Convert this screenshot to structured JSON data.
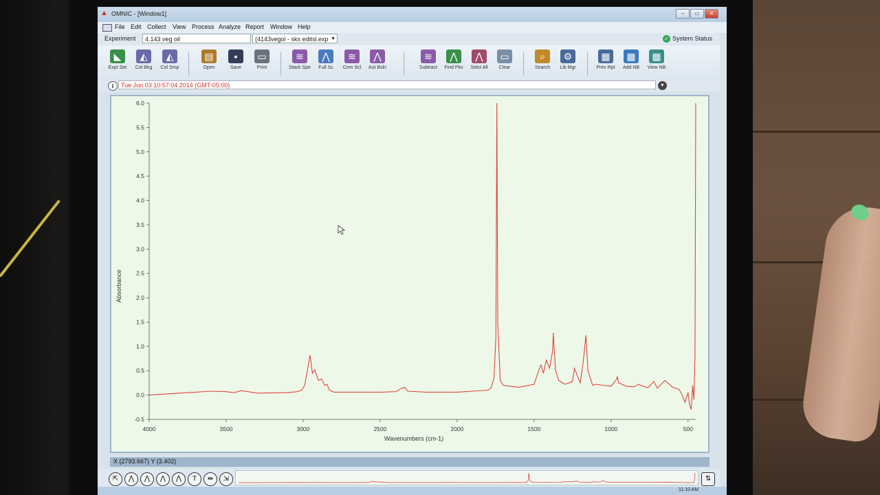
{
  "window": {
    "title": "OMNIC - [Window1]",
    "buttons": {
      "minimize": "–",
      "maximize": "▭",
      "close": "✕"
    }
  },
  "menu": [
    "File",
    "Edit",
    "Collect",
    "View",
    "Process",
    "Analyze",
    "Report",
    "Window",
    "Help"
  ],
  "experiment": {
    "label": "Experiment",
    "name": "4.143 veg oil",
    "file": "(4143vegoi - sks editsl.exp"
  },
  "system_status": "System Status",
  "toolbar": [
    {
      "label": "Expt Set",
      "icon": "expt-set-icon",
      "color": "#3a8f4a"
    },
    {
      "label": "Col Bkg",
      "icon": "collect-background-icon",
      "color": "#6a6aa8"
    },
    {
      "label": "Col Smp",
      "icon": "collect-sample-icon",
      "color": "#6a6aa8"
    },
    {
      "label": "Open",
      "icon": "open-icon",
      "color": "#b07a2a"
    },
    {
      "label": "Save",
      "icon": "save-icon",
      "color": "#333d55"
    },
    {
      "label": "Print",
      "icon": "print-icon",
      "color": "#6a7280"
    },
    {
      "label": "Stack Spe",
      "icon": "stack-spectra-icon",
      "color": "#8a5aa8"
    },
    {
      "label": "Full Sc",
      "icon": "full-scale-icon",
      "color": "#4a7ac0"
    },
    {
      "label": "Cmn Scl",
      "icon": "common-scale-icon",
      "color": "#8a5aa8"
    },
    {
      "label": "Aut Bsln",
      "icon": "auto-baseline-icon",
      "color": "#8a5aa8"
    },
    {
      "label": "Subtract",
      "icon": "subtract-icon",
      "color": "#8a5aa8"
    },
    {
      "label": "Find Pks",
      "icon": "find-peaks-icon",
      "color": "#3a8f4a"
    },
    {
      "label": "Selct All",
      "icon": "select-all-icon",
      "color": "#a04a6a"
    },
    {
      "label": "Clear",
      "icon": "clear-icon",
      "color": "#7a8ea6"
    },
    {
      "label": "Search",
      "icon": "search-icon",
      "color": "#c08a2a"
    },
    {
      "label": "Lib Mgr",
      "icon": "library-manager-icon",
      "color": "#4a6a9a"
    },
    {
      "label": "Prev Rpt",
      "icon": "preview-report-icon",
      "color": "#4a6a9a"
    },
    {
      "label": "Add NB",
      "icon": "add-notebook-icon",
      "color": "#3a7ac0"
    },
    {
      "label": "View NB",
      "icon": "view-notebook-icon",
      "color": "#3a8f8a"
    }
  ],
  "info": {
    "timestamp": "Tue Jun 03 10:57:04 2014 (GMT-05:00)"
  },
  "chart_data": {
    "type": "line",
    "xlabel": "Wavenumbers (cm-1)",
    "ylabel": "Absorbance",
    "xlim": [
      4000,
      450
    ],
    "ylim": [
      -0.5,
      6.0
    ],
    "x_ticks": [
      "4000",
      "3500",
      "3000",
      "2500",
      "2000",
      "1500",
      "1000",
      "500"
    ],
    "x_tick_values": [
      4000,
      3500,
      3000,
      2500,
      2000,
      1500,
      1000,
      500
    ],
    "y_ticks": [
      "6.0",
      "5.5",
      "5.0",
      "4.5",
      "4.0",
      "3.5",
      "3.0",
      "2.5",
      "2.0",
      "1.5",
      "1.0",
      "0.5",
      "0.0",
      "-0.5"
    ],
    "y_tick_values": [
      6.0,
      5.5,
      5.0,
      4.5,
      4.0,
      3.5,
      3.0,
      2.5,
      2.0,
      1.5,
      1.0,
      0.5,
      0.0,
      -0.5
    ],
    "series": [
      {
        "color": "#e0453a",
        "x": [
          4000,
          3900,
          3800,
          3700,
          3600,
          3500,
          3450,
          3400,
          3300,
          3100,
          3040,
          3010,
          2990,
          2970,
          2955,
          2940,
          2925,
          2900,
          2880,
          2860,
          2845,
          2830,
          2800,
          2700,
          2500,
          2400,
          2360,
          2340,
          2320,
          2200,
          2000,
          1900,
          1800,
          1780,
          1760,
          1748,
          1742,
          1736,
          1720,
          1700,
          1650,
          1600,
          1500,
          1465,
          1455,
          1440,
          1420,
          1400,
          1380,
          1375,
          1370,
          1360,
          1340,
          1300,
          1250,
          1238,
          1200,
          1180,
          1163,
          1150,
          1120,
          1100,
          1050,
          1000,
          965,
          960,
          950,
          900,
          850,
          820,
          800,
          760,
          722,
          700,
          650,
          600,
          560,
          540,
          520,
          500,
          490,
          480,
          470,
          462,
          455,
          450
        ],
        "y": [
          0.0,
          0.02,
          0.04,
          0.06,
          0.08,
          0.07,
          0.05,
          0.09,
          0.04,
          0.05,
          0.07,
          0.1,
          0.2,
          0.55,
          0.82,
          0.45,
          0.52,
          0.3,
          0.33,
          0.2,
          0.22,
          0.1,
          0.06,
          0.06,
          0.06,
          0.07,
          0.14,
          0.16,
          0.08,
          0.06,
          0.06,
          0.08,
          0.1,
          0.14,
          0.35,
          1.2,
          6.0,
          1.5,
          0.3,
          0.2,
          0.18,
          0.16,
          0.22,
          0.55,
          0.62,
          0.45,
          0.72,
          0.55,
          0.9,
          1.28,
          0.95,
          0.5,
          0.3,
          0.22,
          0.28,
          0.55,
          0.25,
          0.7,
          1.23,
          0.5,
          0.2,
          0.22,
          0.2,
          0.18,
          0.32,
          0.38,
          0.25,
          0.18,
          0.17,
          0.22,
          0.19,
          0.15,
          0.28,
          0.14,
          0.3,
          0.16,
          0.12,
          0.02,
          -0.15,
          0.05,
          -0.2,
          -0.3,
          0.2,
          -0.1,
          0.8,
          6.0
        ]
      }
    ]
  },
  "status": {
    "cursor": "X (2793.667) Y (3.402)"
  },
  "bottom_tools": [
    "⇱",
    "⋀",
    "⋀",
    "⋀",
    "⋀",
    "T",
    "⇹",
    "⇲"
  ],
  "tray": {
    "time": "11:10 AM"
  }
}
